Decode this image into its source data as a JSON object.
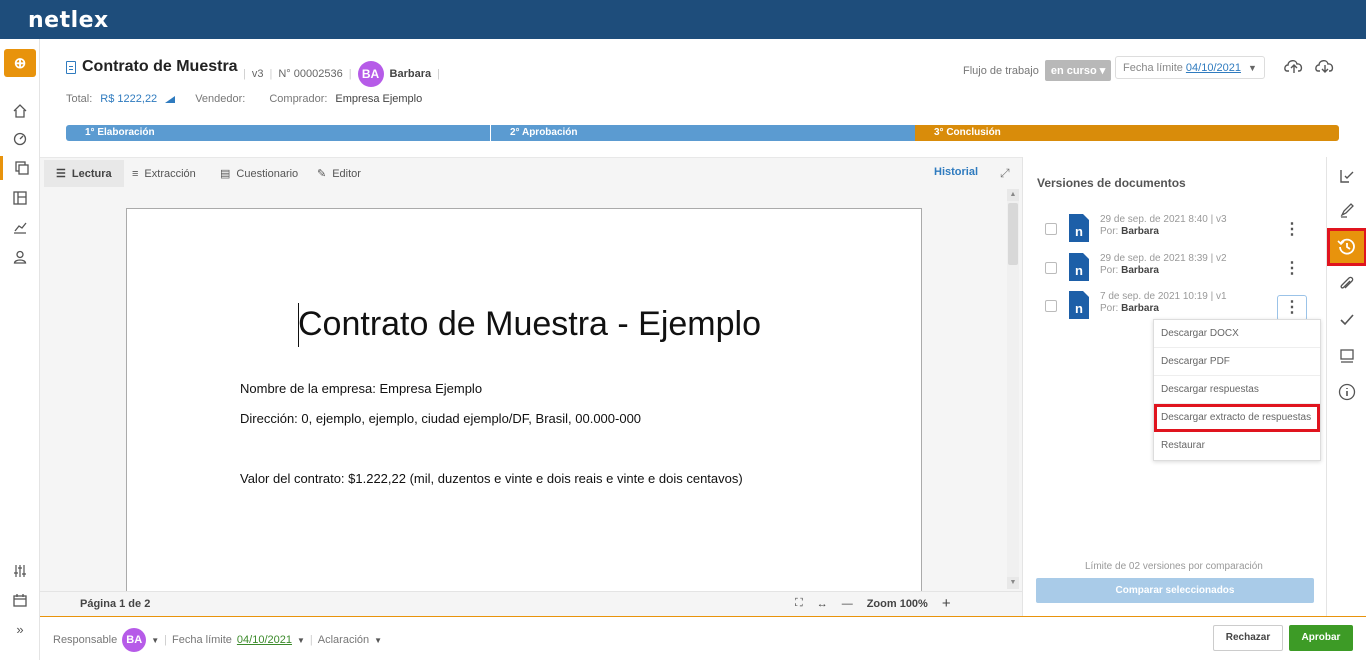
{
  "app": {
    "logo": "netlex"
  },
  "document": {
    "title": "Contrato de Muestra",
    "version": "v3",
    "number": "N° 00002536",
    "owner_initials": "BA",
    "owner_name": "Barbara",
    "total_label": "Total:",
    "total_value": "R$ 1222,22",
    "seller_label": "Vendedor:",
    "buyer_label": "Comprador:",
    "buyer_value": "Empresa Ejemplo"
  },
  "workflow": {
    "label": "Flujo de trabajo",
    "status": "en curso",
    "deadline_label": "Fecha límite",
    "deadline_date": "04/10/2021"
  },
  "steps": [
    "1° Elaboración",
    "2° Aprobación",
    "3° Conclusión"
  ],
  "tabs": [
    "Lectura",
    "Extracción",
    "Cuestionario",
    "Editor"
  ],
  "historial": "Historial",
  "page": {
    "title": "Contrato de Muestra - Ejemplo",
    "lines": [
      "Nombre de la empresa: Empresa Ejemplo",
      "Dirección: 0, ejemplo, ejemplo, ciudad ejemplo/DF, Brasil, 00.000-000",
      "Valor del contrato: $1.222,22 (mil, duzentos e vinte e dois reais e vinte e dois centavos)"
    ]
  },
  "statusbar": {
    "page_info": "Página 1 de 2",
    "zoom": "Zoom 100%"
  },
  "versions_panel": {
    "title": "Versiones de documentos",
    "versions": [
      {
        "date": "29 de sep. de 2021 8:40 | v3",
        "by_label": "Por:",
        "by": "Barbara"
      },
      {
        "date": "29 de sep. de 2021 8:39 | v2",
        "by_label": "Por:",
        "by": "Barbara"
      },
      {
        "date": "7 de sep. de 2021 10:19 | v1",
        "by_label": "Por:",
        "by": "Barbara"
      }
    ],
    "menu": [
      "Descargar DOCX",
      "Descargar PDF",
      "Descargar respuestas",
      "Descargar extracto de respuestas",
      "Restaurar"
    ],
    "limit_text": "Límite de 02 versiones por comparación",
    "compare_button": "Comparar seleccionados"
  },
  "footer": {
    "responsible_label": "Responsable",
    "responsible_initials": "BA",
    "deadline_label": "Fecha límite",
    "deadline_date": "04/10/2021",
    "clarification": "Aclaración",
    "reject": "Rechazar",
    "approve": "Aprobar"
  },
  "colors": {
    "topbar": "#1e4d7b",
    "accent": "#e8930c",
    "step_blue": "#5b9bd1",
    "approve": "#3d9b26",
    "highlight": "#e0141e"
  }
}
